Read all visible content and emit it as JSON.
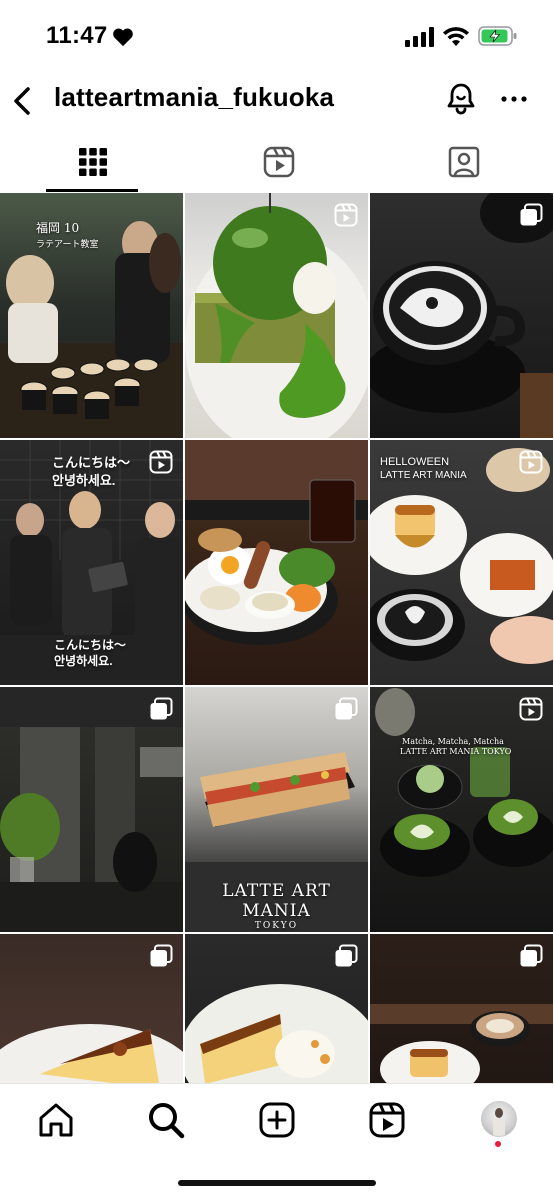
{
  "status_bar": {
    "time": "11:47"
  },
  "header": {
    "username": "latteartmania_fukuoka"
  },
  "tabs": [
    "grid",
    "reels",
    "tagged"
  ],
  "posts": [
    {
      "type": "carousel",
      "lines": [
        "福岡 10",
        "ラテアート教室"
      ]
    },
    {
      "type": "reel"
    },
    {
      "type": "carousel"
    },
    {
      "type": "reel",
      "lines": [
        "こんにちは～",
        "안녕하세요.",
        "こんにちは～",
        "안녕하세요."
      ]
    },
    {
      "type": "none"
    },
    {
      "type": "reel",
      "lines": [
        "HELLOWEEN",
        "LATTE ART MANIA"
      ]
    },
    {
      "type": "carousel"
    },
    {
      "type": "carousel",
      "lines": [
        "LATTE ART",
        "MANIA",
        "TOKYO"
      ]
    },
    {
      "type": "reel",
      "lines": [
        "Matcha, Matcha, Matcha",
        "LATTE ART MANIA TOKYO"
      ]
    },
    {
      "type": "carousel"
    },
    {
      "type": "carousel"
    },
    {
      "type": "carousel"
    }
  ],
  "colors": {
    "accent": "#000000",
    "notification_dot": "#ed1a3a",
    "battery_green": "#34c759"
  },
  "bottom_nav": [
    "home-icon",
    "search-icon",
    "create-icon",
    "reels-icon",
    "profile-avatar"
  ]
}
